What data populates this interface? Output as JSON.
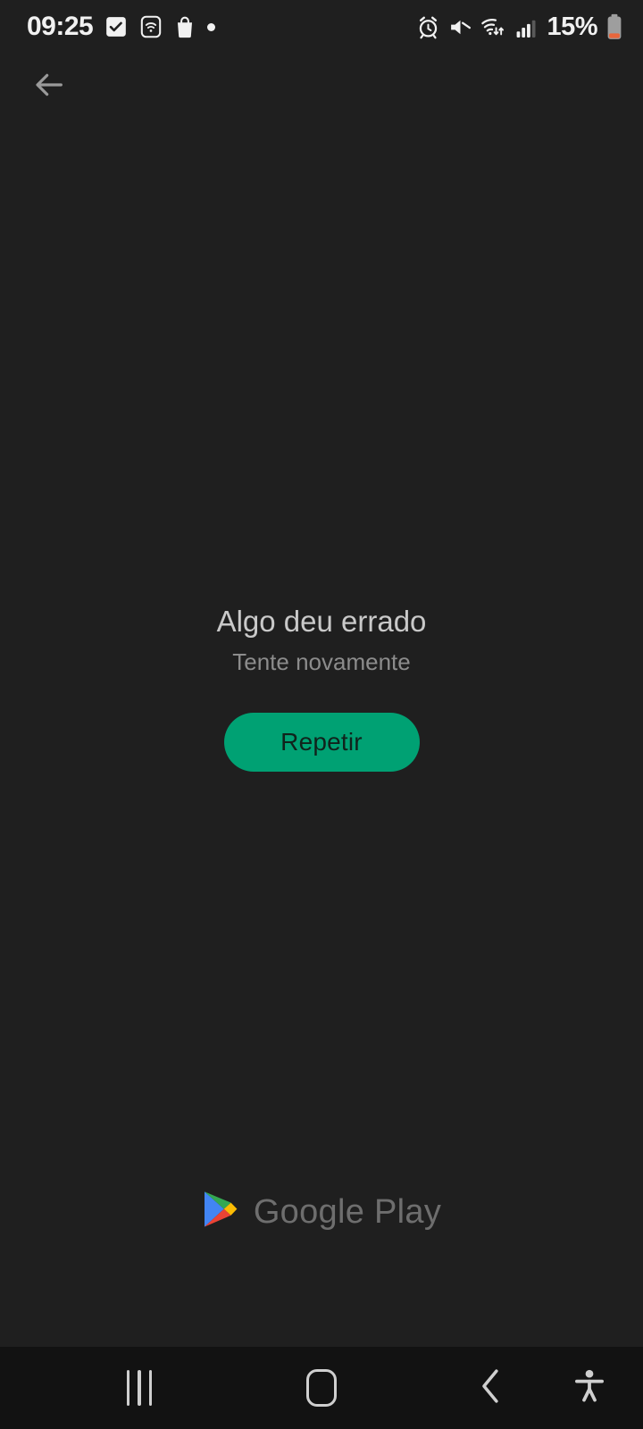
{
  "status_bar": {
    "time": "09:25",
    "battery_percent": "15%",
    "left_icons": [
      {
        "name": "checkbox-checked-icon",
        "label": "task-complete"
      },
      {
        "name": "wifi-box-icon",
        "label": "wifi-app"
      },
      {
        "name": "shopping-bag-icon",
        "label": "store"
      },
      {
        "name": "dot-icon",
        "label": "notification-dot"
      }
    ],
    "right_icons": [
      {
        "name": "alarm-clock-icon",
        "label": "alarm"
      },
      {
        "name": "volume-muted-icon",
        "label": "sound-off"
      },
      {
        "name": "wifi-transfer-icon",
        "label": "wifi"
      },
      {
        "name": "signal-bars-icon",
        "label": "cellular-signal"
      },
      {
        "name": "battery-low-icon",
        "label": "battery"
      }
    ],
    "signal_bars_filled": 3,
    "signal_bars_total": 4,
    "battery_level_color": "#e8663c"
  },
  "top_bar": {
    "back_icon": "arrow-left-icon",
    "back_icon_color": "#9a9a9a"
  },
  "main": {
    "error_title": "Algo deu errado",
    "error_subtitle": "Tente novamente",
    "retry_label": "Repetir",
    "retry_bg_color": "#00a173",
    "retry_text_color": "#10231c",
    "title_color": "#c9c9c9",
    "subtitle_color": "#8c8c8c"
  },
  "brand": {
    "name": "Google Play",
    "text_color": "#6e6e6e",
    "logo_icon": "google-play-logo-icon",
    "logo_colors": {
      "blue": "#4285f4",
      "green": "#34a853",
      "yellow": "#fbbc04",
      "red": "#ea4335"
    }
  },
  "nav_bar": {
    "background": "#121212",
    "icon_color": "#cfcfcf",
    "buttons": [
      {
        "name": "recents-button",
        "icon": "recents-icon"
      },
      {
        "name": "home-button",
        "icon": "home-icon"
      },
      {
        "name": "back-button",
        "icon": "chevron-left-icon"
      },
      {
        "name": "accessibility-button",
        "icon": "accessibility-person-icon"
      }
    ]
  },
  "theme": {
    "page_background": "#1f1f1f"
  }
}
